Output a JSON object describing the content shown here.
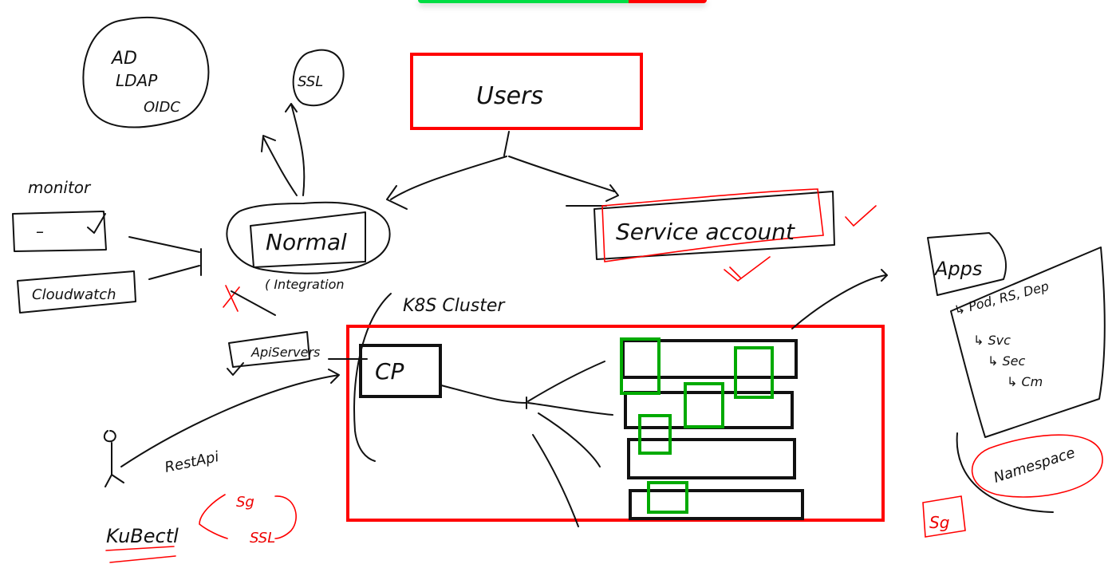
{
  "progress": {
    "fraction_green": 0.73,
    "colors": {
      "green": "#00dd44",
      "red": "#ff0000"
    }
  },
  "labels": {
    "auth": [
      "AD",
      "LDAP",
      "OIDC"
    ],
    "ssl": "SSL",
    "users": "Users",
    "monitor": "monitor",
    "monitor_box": "–",
    "cloudwatch": "Cloudwatch",
    "normal": "Normal",
    "integration": "( Integration",
    "service_account": "Service account",
    "api_servers": "ApiServers",
    "k8s_cluster": "K8S Cluster",
    "cp": "CP",
    "rest_api": "RestApi",
    "kubectl": "KuBectl",
    "sg_left": "Sg",
    "ssl_left": "SSL",
    "apps": "Apps",
    "app_items": [
      "↳ Pod, RS, Dep",
      "↳ Svc",
      "↳ Sec",
      "↳ Cm"
    ],
    "namespace": "Namespace",
    "sg_right": "Sg"
  },
  "colors": {
    "ink": "#111111",
    "red": "#ff0000",
    "green": "#00aa00"
  }
}
